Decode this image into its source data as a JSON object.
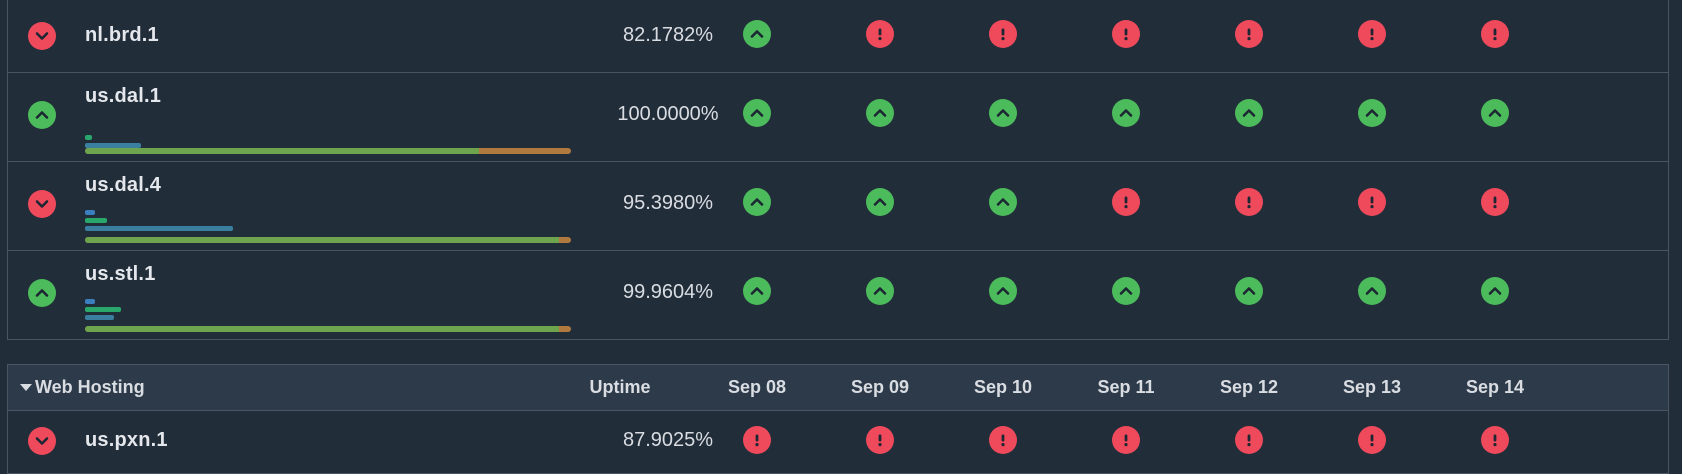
{
  "colors": {
    "up": "#4cbb5b",
    "down": "#ef4a5c",
    "background": "#222d3a",
    "header": "#2d3a4a"
  },
  "section1": {
    "rows": [
      {
        "name": "nl.brd.1",
        "status": "down",
        "uptime": "82.1782%",
        "days": [
          "up",
          "down",
          "down",
          "down",
          "down",
          "down",
          "down"
        ],
        "bars": [],
        "track_pct": null
      },
      {
        "name": "us.dal.1",
        "status": "up",
        "uptime": "100.0000%",
        "days": [
          "up",
          "up",
          "up",
          "up",
          "up",
          "up",
          "up"
        ],
        "bars": [
          {
            "type": "green",
            "frac": 0.015
          },
          {
            "type": "steel",
            "frac": 0.115
          }
        ],
        "track_pct": 0.81
      },
      {
        "name": "us.dal.4",
        "status": "down",
        "uptime": "95.3980%",
        "days": [
          "up",
          "up",
          "up",
          "down",
          "down",
          "down",
          "down"
        ],
        "bars": [
          {
            "type": "blue",
            "frac": 0.02
          },
          {
            "type": "green",
            "frac": 0.045
          },
          {
            "type": "steel",
            "frac": 0.305
          }
        ],
        "track_pct": 0.975
      },
      {
        "name": "us.stl.1",
        "status": "up",
        "uptime": "99.9604%",
        "days": [
          "up",
          "up",
          "up",
          "up",
          "up",
          "up",
          "up"
        ],
        "bars": [
          {
            "type": "blue",
            "frac": 0.02
          },
          {
            "type": "green",
            "frac": 0.075
          },
          {
            "type": "steel",
            "frac": 0.06
          }
        ],
        "track_pct": 0.975
      }
    ]
  },
  "section2": {
    "group_label": "Web Hosting",
    "uptime_header": "Uptime",
    "day_headers": [
      "Sep 08",
      "Sep 09",
      "Sep 10",
      "Sep 11",
      "Sep 12",
      "Sep 13",
      "Sep 14"
    ],
    "rows": [
      {
        "name": "us.pxn.1",
        "status": "down",
        "uptime": "87.9025%",
        "days": [
          "down",
          "down",
          "down",
          "down",
          "down",
          "down",
          "down"
        ]
      }
    ]
  }
}
